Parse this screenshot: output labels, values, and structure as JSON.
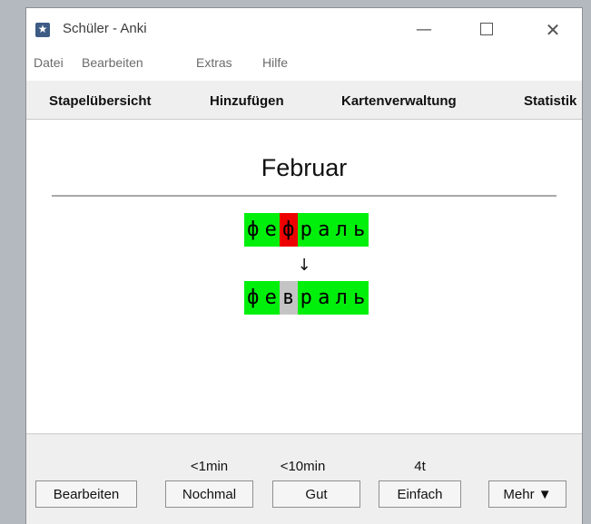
{
  "window": {
    "title": "Schüler - Anki",
    "minimize_glyph": "—",
    "close_glyph": "✕"
  },
  "menu": {
    "items": [
      "Datei",
      "Bearbeiten",
      "Extras",
      "Hilfe"
    ]
  },
  "toolbar": {
    "items": [
      "Stapelübersicht",
      "Hinzufügen",
      "Kartenverwaltung",
      "Statistik"
    ]
  },
  "card": {
    "front": "Februar",
    "typed": [
      {
        "char": "ф",
        "status": "good"
      },
      {
        "char": "е",
        "status": "good"
      },
      {
        "char": "ф",
        "status": "bad"
      },
      {
        "char": "р",
        "status": "good"
      },
      {
        "char": "а",
        "status": "good"
      },
      {
        "char": "л",
        "status": "good"
      },
      {
        "char": "ь",
        "status": "good"
      }
    ],
    "arrow": "↓",
    "correct": [
      {
        "char": "ф",
        "status": "good"
      },
      {
        "char": "е",
        "status": "good"
      },
      {
        "char": "в",
        "status": "missed"
      },
      {
        "char": "р",
        "status": "good"
      },
      {
        "char": "а",
        "status": "good"
      },
      {
        "char": "л",
        "status": "good"
      },
      {
        "char": "ь",
        "status": "good"
      }
    ],
    "colors": {
      "good": "#00f00c",
      "bad": "#ec0000",
      "missed": "#c4c4c4"
    }
  },
  "answer": {
    "edit_label": "Bearbeiten",
    "buttons": [
      {
        "time": "<1min",
        "label": "Nochmal"
      },
      {
        "time": "<10min",
        "label": "Gut"
      },
      {
        "time": "4t",
        "label": "Einfach"
      }
    ],
    "more_label": "Mehr ▼"
  }
}
